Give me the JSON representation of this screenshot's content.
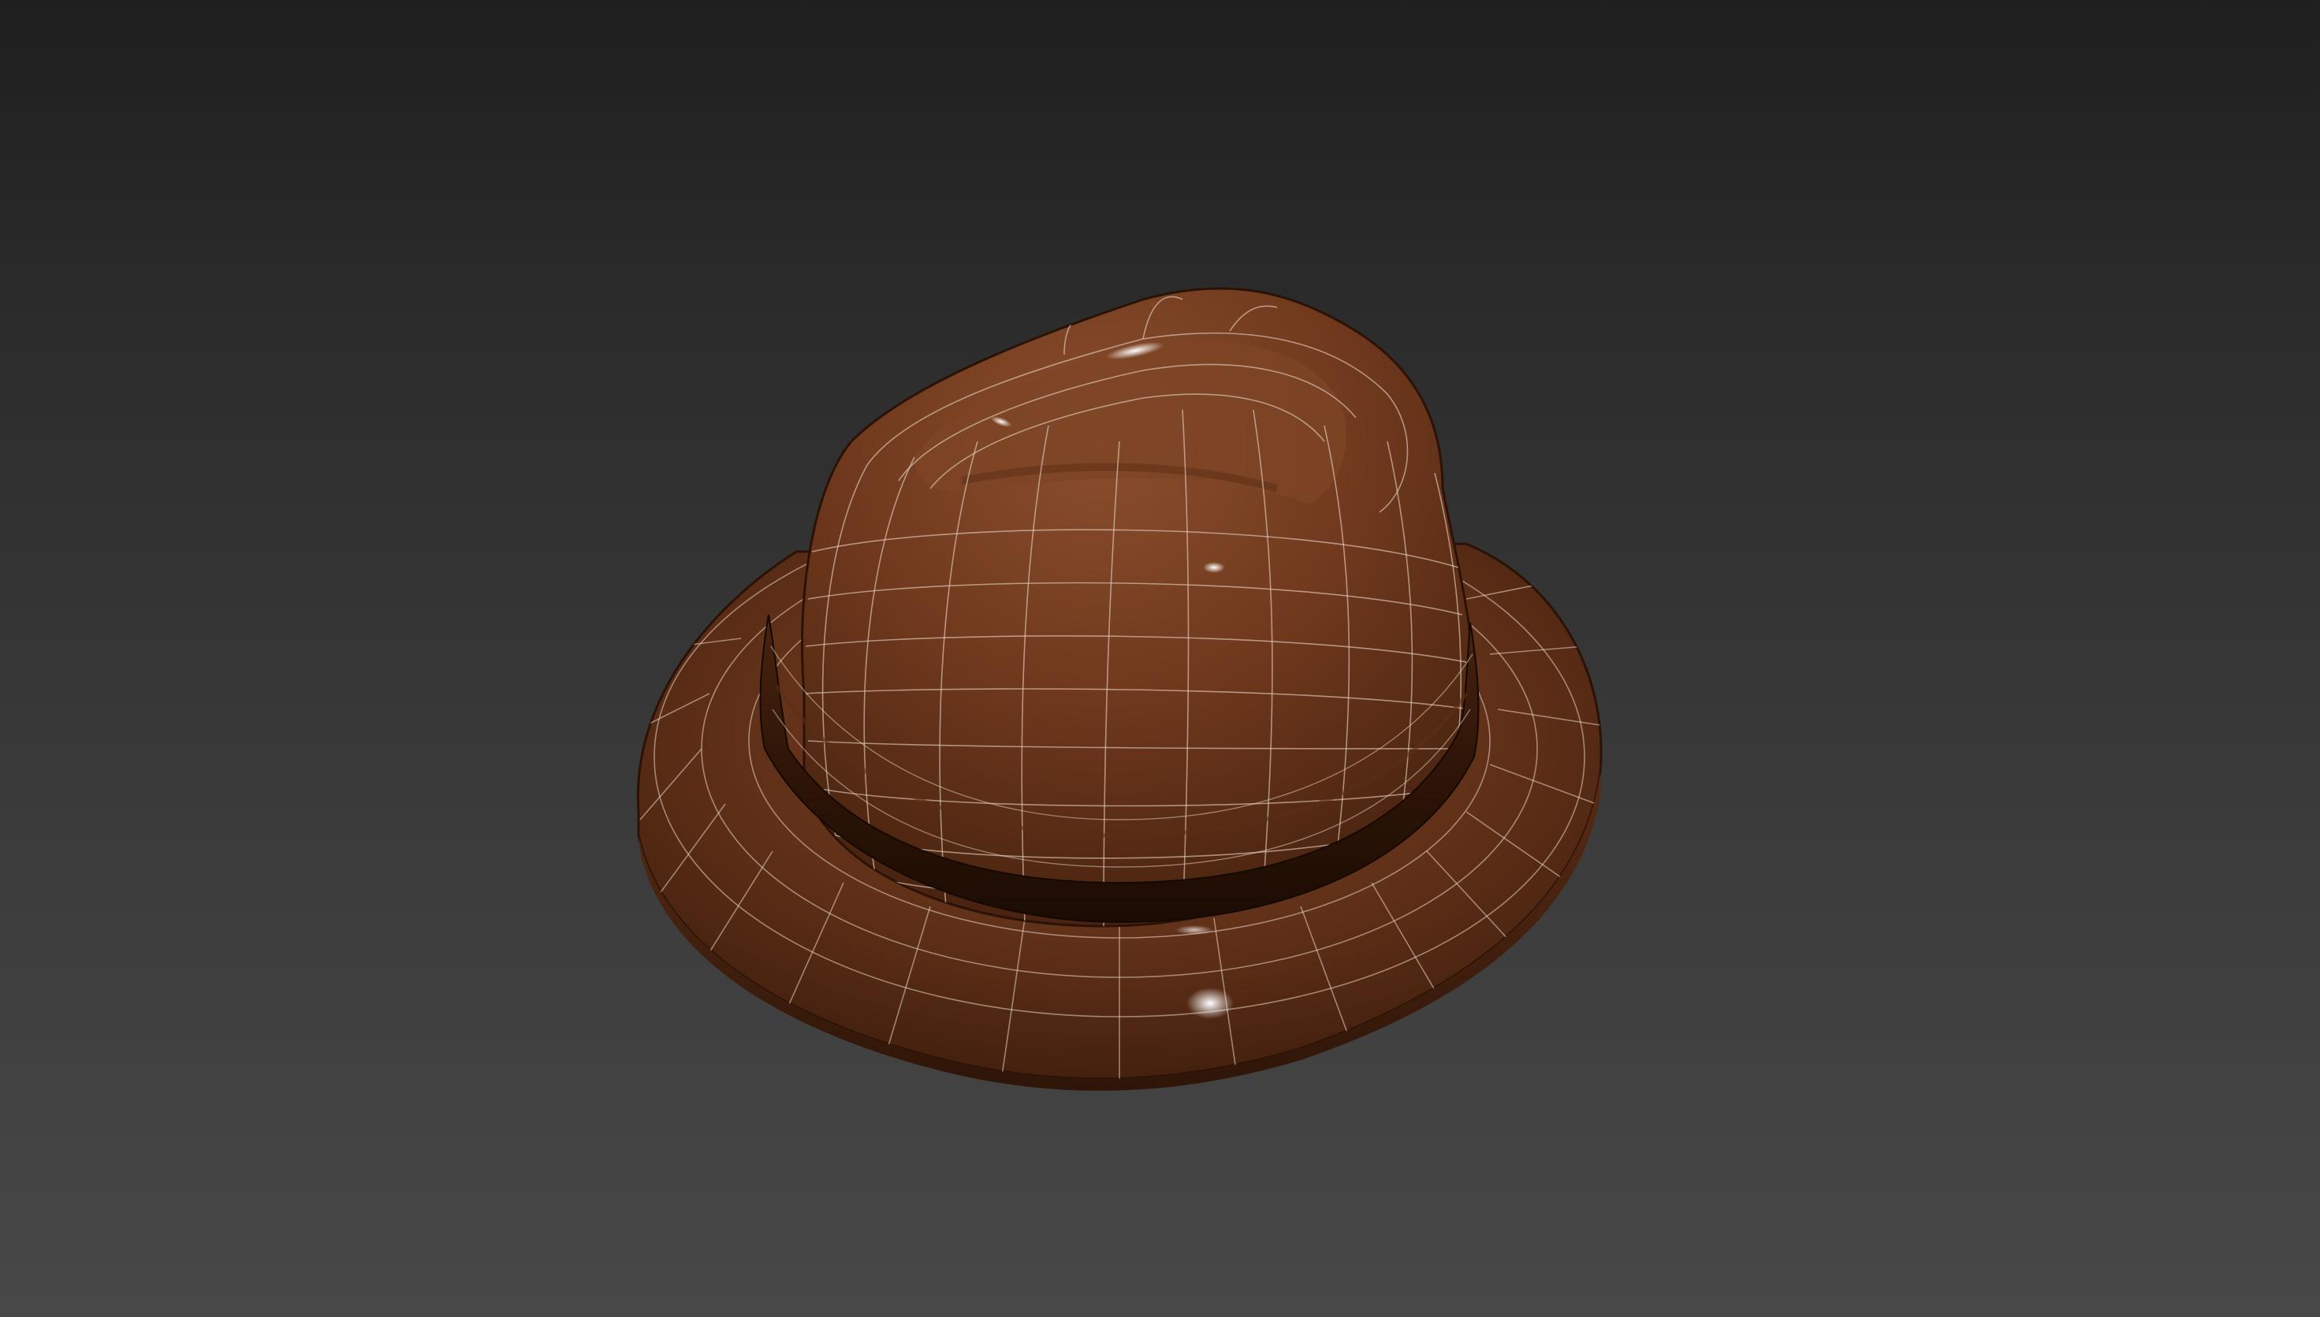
{
  "viewport": {
    "background_top": "#1f1f1f",
    "background_bottom": "#484848",
    "display_mode": "shaded-with-wireframe"
  },
  "model": {
    "object": "hat",
    "material_color": "#6e3a1f",
    "band_color": "#3a1d0c",
    "wire_color": "#e8d6c6",
    "highlight_color": "#ffffff"
  }
}
